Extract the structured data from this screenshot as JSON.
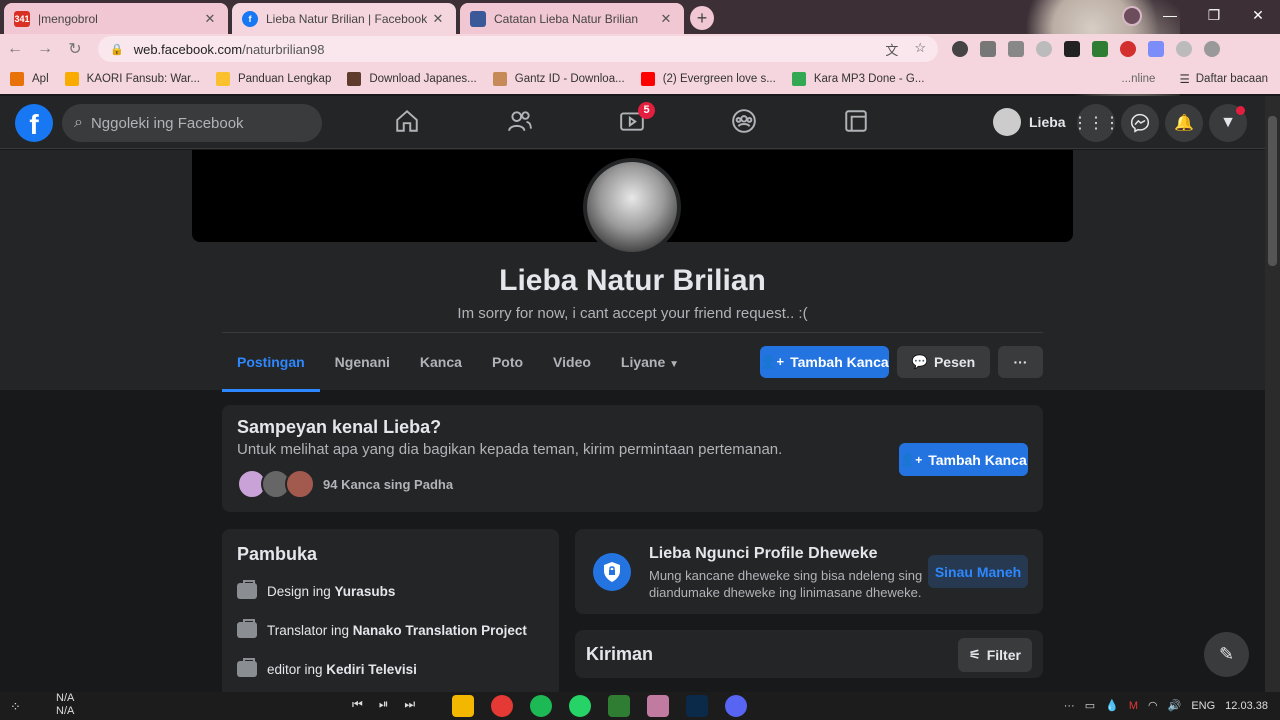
{
  "browser": {
    "tabs": [
      {
        "title": "|mengobrol",
        "favicon_text": "341",
        "favicon_color": "#d93025",
        "active": false
      },
      {
        "title": "Lieba Natur Brilian | Facebook",
        "favicon_text": "f",
        "favicon_color": "#1877f2",
        "active": true
      },
      {
        "title": "Catatan Lieba Natur Brilian",
        "favicon_text": "",
        "favicon_color": "#3b5998",
        "active": false
      }
    ],
    "new_tab": "+",
    "url_domain": "web.facebook.com",
    "url_path": "/naturbrilian98",
    "bookmarks": [
      {
        "label": "Apl",
        "color": "#e8710a"
      },
      {
        "label": "KAORI Fansub: War...",
        "color": "#f9ab00"
      },
      {
        "label": "Panduan Lengkap",
        "color": "#fbc02d"
      },
      {
        "label": "Download Japanes...",
        "color": "#5f3b2b"
      },
      {
        "label": "Gantz ID - Downloa...",
        "color": "#c58a57"
      },
      {
        "label": "(2) Evergreen love s...",
        "color": "#ff0000"
      },
      {
        "label": "Kara MP3 Done - G...",
        "color": "#34a853"
      }
    ],
    "bookmarks_right_partial": "...nline",
    "reading_list": "Daftar bacaan"
  },
  "fb": {
    "search_placeholder": "Nggoleki ing Facebook",
    "watch_badge": "5",
    "user_name": "Lieba"
  },
  "profile": {
    "name": "Lieba Natur Brilian",
    "bio": "Im sorry for now, i cant accept your friend request.. :(",
    "tabs": [
      "Postingan",
      "Ngenani",
      "Kanca",
      "Poto",
      "Video",
      "Liyane"
    ],
    "add_friend": "Tambah Kanca",
    "message": "Pesen",
    "more": "···"
  },
  "know_card": {
    "title": "Sampeyan kenal Lieba?",
    "subtitle": "Untuk melihat apa yang dia bagikan kepada teman, kirim permintaan pertemanan.",
    "mutual": "94 Kanca sing Padha",
    "button": "Tambah Kanca"
  },
  "intro": {
    "title": "Pambuka",
    "items": [
      {
        "prefix": "Design ing ",
        "bold": "Yurasubs"
      },
      {
        "prefix": "Translator ing ",
        "bold": "Nanako Translation Project"
      },
      {
        "prefix": "editor ing ",
        "bold": "Kediri Televisi"
      }
    ]
  },
  "lock_card": {
    "title": "Lieba Ngunci Profile Dheweke",
    "description": "Mung kancane dheweke sing bisa ndeleng sing diandumake dheweke ing linimasane dheweke.",
    "button": "Sinau Maneh"
  },
  "posts": {
    "title": "Kiriman",
    "filter": "Filter"
  },
  "taskbar": {
    "media_line1": "N/A",
    "media_line2": "N/A",
    "lang": "ENG",
    "time": "12.03.38"
  }
}
